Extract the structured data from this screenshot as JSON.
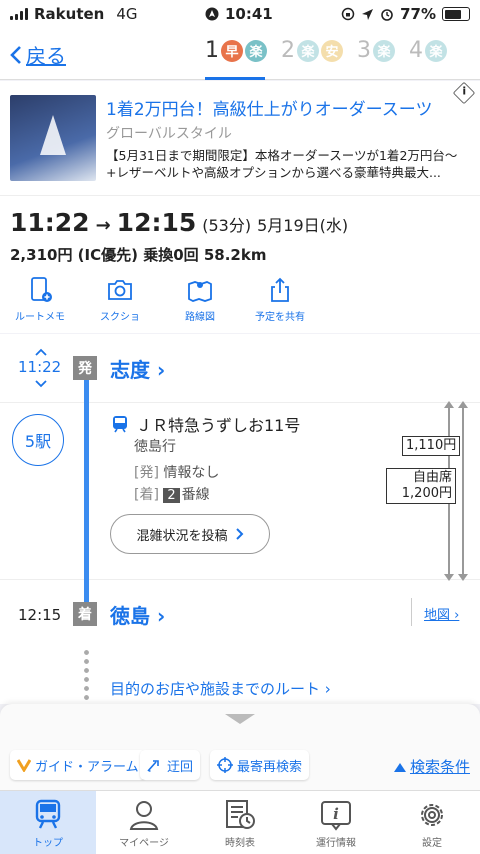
{
  "status": {
    "carrier": "Rakuten",
    "network": "4G",
    "time": "10:41",
    "battery": "77%",
    "battery_level": 0.77
  },
  "nav": {
    "back_label": "戻る",
    "routes": [
      {
        "num": "1",
        "badges": [
          {
            "text": "早",
            "kind": "fast"
          },
          {
            "text": "楽",
            "kind": "easy"
          }
        ],
        "selected": true
      },
      {
        "num": "2",
        "badges": [
          {
            "text": "楽",
            "kind": "easy"
          },
          {
            "text": "安",
            "kind": "safe"
          }
        ],
        "selected": false
      },
      {
        "num": "3",
        "badges": [
          {
            "text": "楽",
            "kind": "easy"
          }
        ],
        "selected": false
      },
      {
        "num": "4",
        "badges": [
          {
            "text": "楽",
            "kind": "easy"
          }
        ],
        "selected": false
      }
    ]
  },
  "ad": {
    "title": "1着2万円台！高級仕上がりオーダースーツ",
    "advertiser": "グローバルスタイル",
    "body": "【5月31日まで期間限定】本格オーダースーツが1着2万円台〜+レザーベルトや高級オプションから選べる豪華特典最大..."
  },
  "summary": {
    "depart": "11:22",
    "arrow": "→",
    "arrive": "12:15",
    "duration": "(53分)",
    "date": "5月19日(水)",
    "fare_line": "2,310円 (IC優先) 乗換0回 58.2km",
    "actions": [
      {
        "label": "ルートメモ",
        "icon": "memo-icon"
      },
      {
        "label": "スクショ",
        "icon": "camera-icon"
      },
      {
        "label": "路線図",
        "icon": "map-icon"
      },
      {
        "label": "予定を共有",
        "icon": "share-icon"
      }
    ]
  },
  "route": {
    "from": {
      "time": "11:22",
      "tag": "発",
      "name": "志度 ›"
    },
    "stops": "5駅",
    "train": "ＪＲ特急うずしお11号",
    "direction": "徳島行",
    "dep_label": "[発]",
    "dep_info": "情報なし",
    "arr_label": "[着]",
    "platform_num": "2",
    "platform_suffix": "番線",
    "post_button": "混雑状況を投稿",
    "fare": "1,110円",
    "seat_type": "自由席",
    "seat_fare": "1,200円",
    "to": {
      "time": "12:15",
      "tag": "着",
      "name": "徳島 ›"
    },
    "map_link": "地図 ›",
    "dest_link": "目的のお店や施設までのルート ›"
  },
  "panel": {
    "guide": "ガイド・アラーム",
    "detour": "迂回",
    "nearest": "最寄再検索",
    "conditions": "検索条件"
  },
  "tabbar": [
    {
      "label": "トップ",
      "icon": "train-icon",
      "selected": true
    },
    {
      "label": "マイページ",
      "icon": "person-icon",
      "selected": false
    },
    {
      "label": "時刻表",
      "icon": "timetable-icon",
      "selected": false
    },
    {
      "label": "運行情報",
      "icon": "info-icon",
      "selected": false
    },
    {
      "label": "設定",
      "icon": "gear-icon",
      "selected": false
    }
  ]
}
